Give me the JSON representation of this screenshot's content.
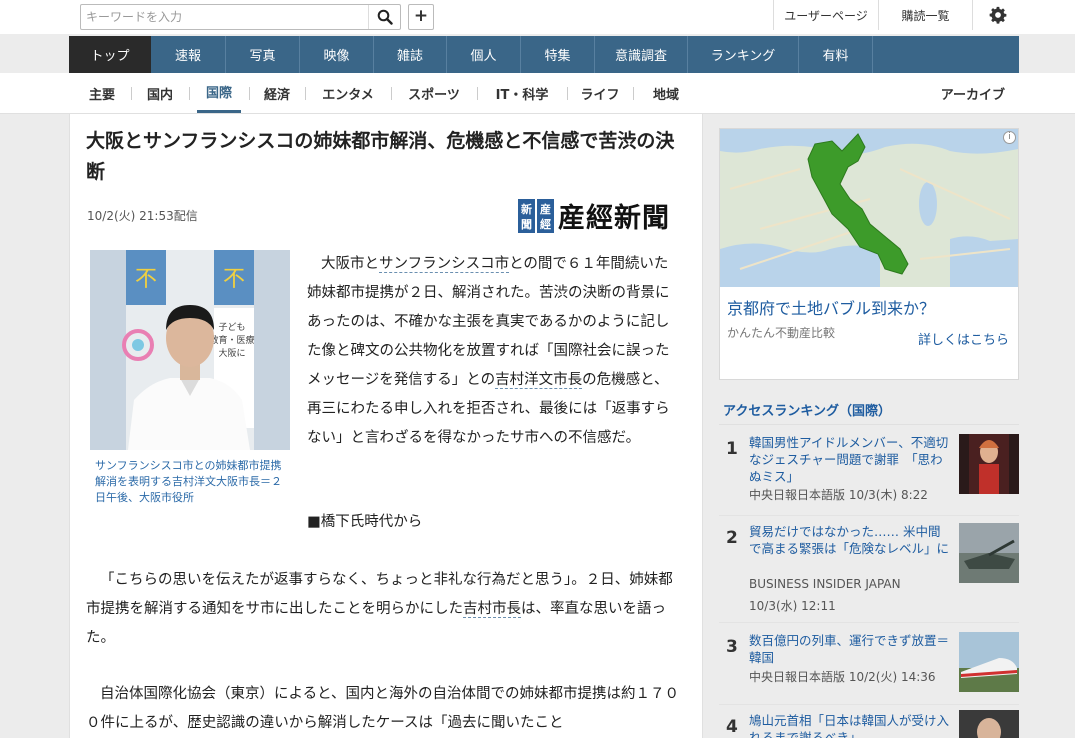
{
  "search": {
    "placeholder": "キーワードを入力",
    "add_label": "+"
  },
  "top_links": {
    "user_page": "ユーザーページ",
    "subscriptions": "購読一覧"
  },
  "main_nav": [
    "トップ",
    "速報",
    "写真",
    "映像",
    "雑誌",
    "個人",
    "特集",
    "意識調査",
    "ランキング",
    "有料"
  ],
  "sub_nav": [
    "主要",
    "国内",
    "国際",
    "経済",
    "エンタメ",
    "スポーツ",
    "IT・科学",
    "ライフ",
    "地域"
  ],
  "sub_nav_active": "国際",
  "archive_label": "アーカイブ",
  "article": {
    "title": "大阪とサンフランシスコの姉妹都市解消、危機感と不信感で苦渋の決断",
    "date": "10/2(火) 21:53配信",
    "publisher": "産經新聞",
    "publisher_seal": [
      "新",
      "産",
      "聞",
      "經"
    ],
    "photo_caption": "サンフランシスコ市との姉妹都市提携解消を表明する吉村洋文大阪市長＝２日午後、大阪市役所",
    "photo_sign_text": [
      "子ども",
      "教育・医療",
      "大阪に"
    ],
    "p1_a": "大阪市と",
    "p1_link": "サンフランシスコ市",
    "p1_b": "との間で６１年間続いた姉妹都市提携が２日、解消された。苦渋の決断の背景にあったのは、不確かな主張を真実であるかのように記した像と碑文の公共物化を放置すれば「国際社会に誤ったメッセージを発信する」との",
    "p1_link2": "吉村洋文市長",
    "p1_c": "の危機感と、再三にわたる申し入れを拒否され、最後には「返事すらない」と言わざるを得なかったサ市への不信感だ。",
    "p2": "■橋下氏時代から",
    "p3_a": "「こちらの思いを伝えたが返事すらなく、ちょっと非礼な行為だと思う」。２日、姉妹都市提携を解消する通知をサ市に出したことを明らかにした",
    "p3_link": "吉村市長",
    "p3_b": "は、率直な思いを語った。",
    "p4": "自治体国際化協会（東京）によると、国内と海外の自治体間での姉妹都市提携は約１７００件に上るが、歴史認識の違いから解消したケースは「過去に聞いたこと"
  },
  "ad": {
    "title": "京都府で土地バブル到来か？",
    "sponsor": "かんたん不動産比較",
    "more": "詳しくはこちら",
    "info": "i"
  },
  "ranking": {
    "title": "アクセスランキング（国際）",
    "items": [
      {
        "rank": "1",
        "title": "韓国男性アイドルメンバー、不適切なジェスチャー問題で謝罪　「思わぬミス」",
        "source": "中央日報日本語版 10/3(木) 8:22"
      },
      {
        "rank": "2",
        "title": "貿易だけではなかった…… 米中間で高まる緊張は「危険なレベル」に",
        "source": "BUSINESS INSIDER JAPAN",
        "date": "10/3(水) 12:11"
      },
      {
        "rank": "3",
        "title": "数百億円の列車、運行できず放置＝韓国",
        "source": "中央日報日本語版 10/2(火) 14:36"
      },
      {
        "rank": "4",
        "title": "鳩山元首相「日本は韓国人が受け入れるまで謝るべき」",
        "source": ""
      }
    ]
  },
  "colors": {
    "nav_bg": "#3a6688",
    "nav_active": "#2a2a2a",
    "link": "#1e5ca0",
    "kyoto_green": "#3d9b2a"
  }
}
